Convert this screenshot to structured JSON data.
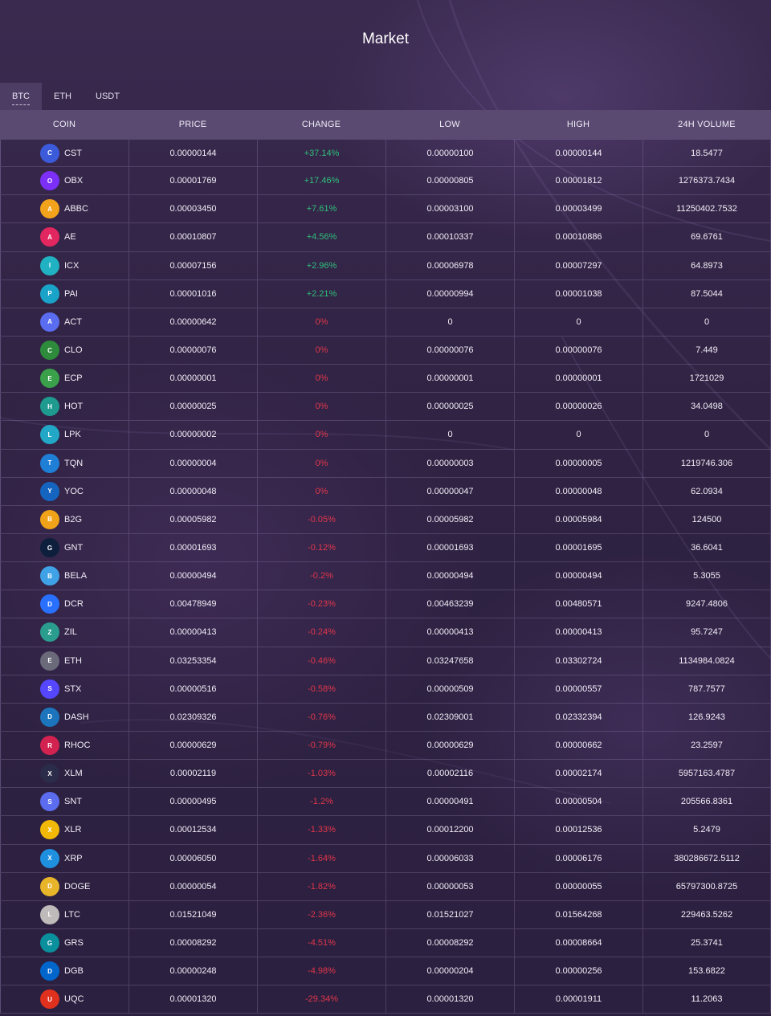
{
  "page": {
    "title": "Market"
  },
  "tabs": [
    {
      "label": "BTC",
      "active": true
    },
    {
      "label": "ETH",
      "active": false
    },
    {
      "label": "USDT",
      "active": false
    }
  ],
  "columns": [
    "COIN",
    "PRICE",
    "CHANGE",
    "LOW",
    "HIGH",
    "24H VOLUME"
  ],
  "colors": {
    "up": "#2fbf7a",
    "down": "#e0364a"
  },
  "rows": [
    {
      "coin": "CST",
      "icon": "cst-icon",
      "icon_color": "#3b5bdb",
      "price": "0.00000144",
      "change": "+37.14%",
      "dir": "up",
      "low": "0.00000100",
      "high": "0.00000144",
      "volume": "18.5477"
    },
    {
      "coin": "OBX",
      "icon": "obx-icon",
      "icon_color": "#7b2ff7",
      "price": "0.00001769",
      "change": "+17.46%",
      "dir": "up",
      "low": "0.00000805",
      "high": "0.00001812",
      "volume": "1276373.7434"
    },
    {
      "coin": "ABBC",
      "icon": "abbc-icon",
      "icon_color": "#f2a31b",
      "price": "0.00003450",
      "change": "+7.61%",
      "dir": "up",
      "low": "0.00003100",
      "high": "0.00003499",
      "volume": "11250402.7532"
    },
    {
      "coin": "AE",
      "icon": "ae-icon",
      "icon_color": "#e2265f",
      "price": "0.00010807",
      "change": "+4.56%",
      "dir": "up",
      "low": "0.00010337",
      "high": "0.00010886",
      "volume": "69.6761"
    },
    {
      "coin": "ICX",
      "icon": "icx-icon",
      "icon_color": "#20b2c2",
      "price": "0.00007156",
      "change": "+2.96%",
      "dir": "up",
      "low": "0.00006978",
      "high": "0.00007297",
      "volume": "64.8973"
    },
    {
      "coin": "PAI",
      "icon": "pai-icon",
      "icon_color": "#1aa3c9",
      "price": "0.00001016",
      "change": "+2.21%",
      "dir": "up",
      "low": "0.00000994",
      "high": "0.00001038",
      "volume": "87.5044"
    },
    {
      "coin": "ACT",
      "icon": "act-icon",
      "icon_color": "#5a6cf0",
      "price": "0.00000642",
      "change": "0%",
      "dir": "down",
      "low": "0",
      "high": "0",
      "volume": "0"
    },
    {
      "coin": "CLO",
      "icon": "clo-icon",
      "icon_color": "#2e8b3c",
      "price": "0.00000076",
      "change": "0%",
      "dir": "down",
      "low": "0.00000076",
      "high": "0.00000076",
      "volume": "7.449"
    },
    {
      "coin": "ECP",
      "icon": "ecp-icon",
      "icon_color": "#3aa04a",
      "price": "0.00000001",
      "change": "0%",
      "dir": "down",
      "low": "0.00000001",
      "high": "0.00000001",
      "volume": "1721029"
    },
    {
      "coin": "HOT",
      "icon": "hot-icon",
      "icon_color": "#1e9a8f",
      "price": "0.00000025",
      "change": "0%",
      "dir": "down",
      "low": "0.00000025",
      "high": "0.00000026",
      "volume": "34.0498"
    },
    {
      "coin": "LPK",
      "icon": "lpk-icon",
      "icon_color": "#22a7c7",
      "price": "0.00000002",
      "change": "0%",
      "dir": "down",
      "low": "0",
      "high": "0",
      "volume": "0"
    },
    {
      "coin": "TQN",
      "icon": "tqn-icon",
      "icon_color": "#1f7fd6",
      "price": "0.00000004",
      "change": "0%",
      "dir": "down",
      "low": "0.00000003",
      "high": "0.00000005",
      "volume": "1219746.306"
    },
    {
      "coin": "YOC",
      "icon": "yoc-icon",
      "icon_color": "#1565c0",
      "price": "0.00000048",
      "change": "0%",
      "dir": "down",
      "low": "0.00000047",
      "high": "0.00000048",
      "volume": "62.0934"
    },
    {
      "coin": "B2G",
      "icon": "b2g-icon",
      "icon_color": "#f0a318",
      "price": "0.00005982",
      "change": "-0.05%",
      "dir": "down",
      "low": "0.00005982",
      "high": "0.00005984",
      "volume": "124500"
    },
    {
      "coin": "GNT",
      "icon": "gnt-icon",
      "icon_color": "#0d1f3c",
      "price": "0.00001693",
      "change": "-0.12%",
      "dir": "down",
      "low": "0.00001693",
      "high": "0.00001695",
      "volume": "36.6041"
    },
    {
      "coin": "BELA",
      "icon": "bela-icon",
      "icon_color": "#3fa2e6",
      "price": "0.00000494",
      "change": "-0.2%",
      "dir": "down",
      "low": "0.00000494",
      "high": "0.00000494",
      "volume": "5.3055"
    },
    {
      "coin": "DCR",
      "icon": "dcr-icon",
      "icon_color": "#2970ff",
      "price": "0.00478949",
      "change": "-0.23%",
      "dir": "down",
      "low": "0.00463239",
      "high": "0.00480571",
      "volume": "9247.4806"
    },
    {
      "coin": "ZIL",
      "icon": "zil-icon",
      "icon_color": "#2a9d8f",
      "price": "0.00000413",
      "change": "-0.24%",
      "dir": "down",
      "low": "0.00000413",
      "high": "0.00000413",
      "volume": "95.7247"
    },
    {
      "coin": "ETH",
      "icon": "eth-icon",
      "icon_color": "#6a6a7a",
      "price": "0.03253354",
      "change": "-0.46%",
      "dir": "down",
      "low": "0.03247658",
      "high": "0.03302724",
      "volume": "1134984.0824"
    },
    {
      "coin": "STX",
      "icon": "stx-icon",
      "icon_color": "#5546ff",
      "price": "0.00000516",
      "change": "-0.58%",
      "dir": "down",
      "low": "0.00000509",
      "high": "0.00000557",
      "volume": "787.7577"
    },
    {
      "coin": "DASH",
      "icon": "dash-icon",
      "icon_color": "#1c75bc",
      "price": "0.02309326",
      "change": "-0.76%",
      "dir": "down",
      "low": "0.02309001",
      "high": "0.02332394",
      "volume": "126.9243"
    },
    {
      "coin": "RHOC",
      "icon": "rhoc-icon",
      "icon_color": "#d2224f",
      "price": "0.00000629",
      "change": "-0.79%",
      "dir": "down",
      "low": "0.00000629",
      "high": "0.00000662",
      "volume": "23.2597"
    },
    {
      "coin": "XLM",
      "icon": "xlm-icon",
      "icon_color": "#2b2b4a",
      "price": "0.00002119",
      "change": "-1.03%",
      "dir": "down",
      "low": "0.00002116",
      "high": "0.00002174",
      "volume": "5957163.4787"
    },
    {
      "coin": "SNT",
      "icon": "snt-icon",
      "icon_color": "#5b6dee",
      "price": "0.00000495",
      "change": "-1.2%",
      "dir": "down",
      "low": "0.00000491",
      "high": "0.00000504",
      "volume": "205566.8361"
    },
    {
      "coin": "XLR",
      "icon": "xlr-icon",
      "icon_color": "#f2b807",
      "price": "0.00012534",
      "change": "-1.33%",
      "dir": "down",
      "low": "0.00012200",
      "high": "0.00012536",
      "volume": "5.2479"
    },
    {
      "coin": "XRP",
      "icon": "xrp-icon",
      "icon_color": "#1f8fe0",
      "price": "0.00006050",
      "change": "-1.64%",
      "dir": "down",
      "low": "0.00006033",
      "high": "0.00006176",
      "volume": "380286672.5112"
    },
    {
      "coin": "DOGE",
      "icon": "doge-icon",
      "icon_color": "#e8b42a",
      "price": "0.00000054",
      "change": "-1.82%",
      "dir": "down",
      "low": "0.00000053",
      "high": "0.00000055",
      "volume": "65797300.8725"
    },
    {
      "coin": "LTC",
      "icon": "ltc-icon",
      "icon_color": "#bfbbbb",
      "price": "0.01521049",
      "change": "-2.36%",
      "dir": "down",
      "low": "0.01521027",
      "high": "0.01564268",
      "volume": "229463.5262"
    },
    {
      "coin": "GRS",
      "icon": "grs-icon",
      "icon_color": "#0a8f9c",
      "price": "0.00008292",
      "change": "-4.51%",
      "dir": "down",
      "low": "0.00008292",
      "high": "0.00008664",
      "volume": "25.3741"
    },
    {
      "coin": "DGB",
      "icon": "dgb-icon",
      "icon_color": "#0066cc",
      "price": "0.00000248",
      "change": "-4.98%",
      "dir": "down",
      "low": "0.00000204",
      "high": "0.00000256",
      "volume": "153.6822"
    },
    {
      "coin": "UQC",
      "icon": "uqc-icon",
      "icon_color": "#e0301e",
      "price": "0.00001320",
      "change": "-29.34%",
      "dir": "down",
      "low": "0.00001320",
      "high": "0.00001911",
      "volume": "11.2063"
    }
  ]
}
